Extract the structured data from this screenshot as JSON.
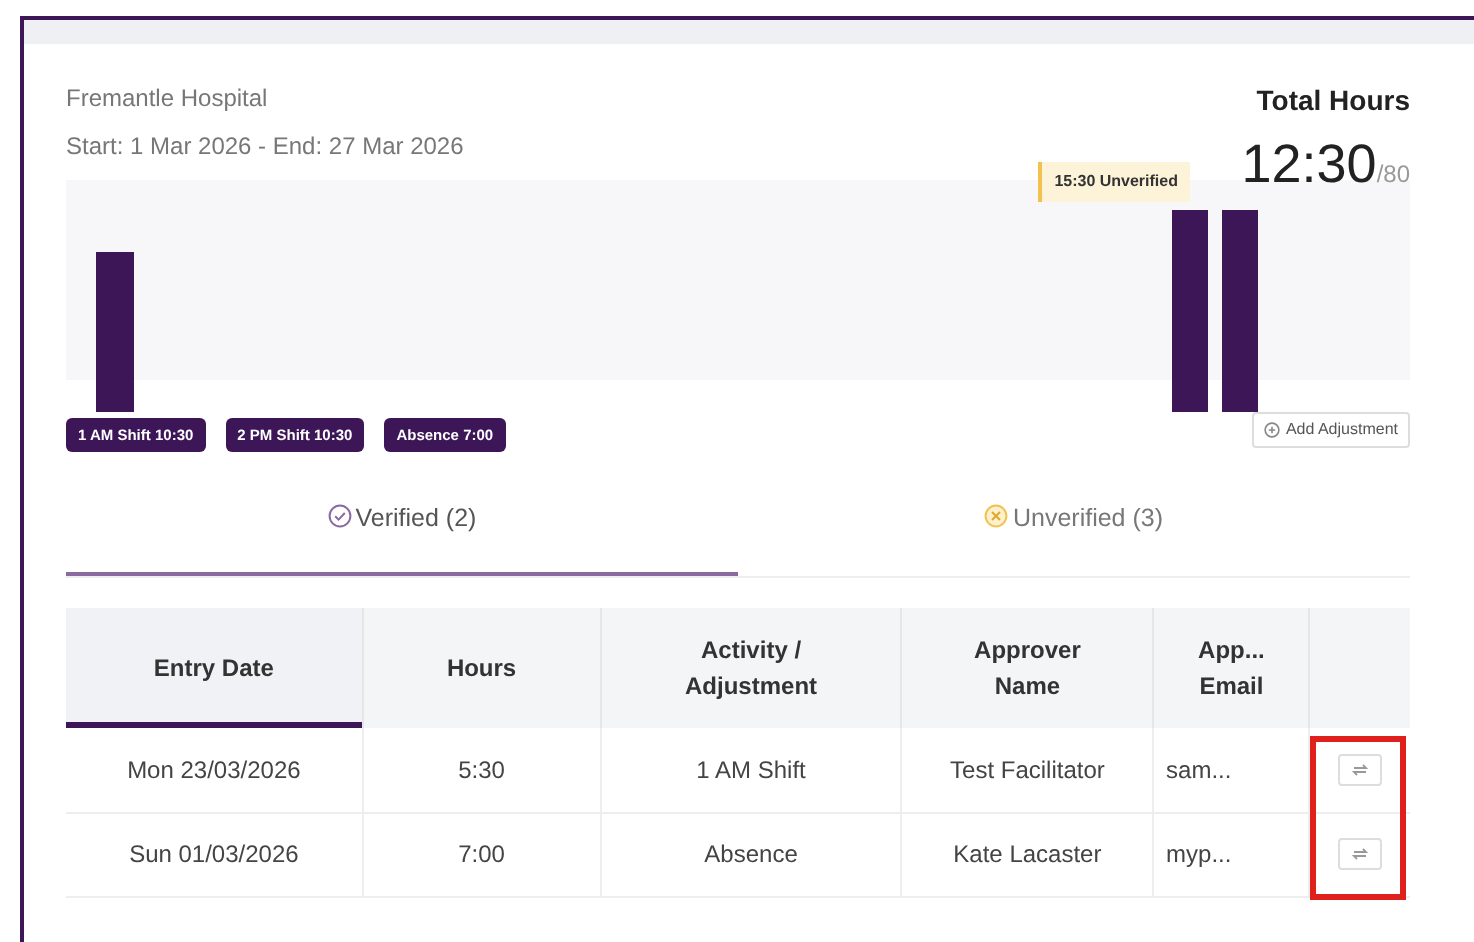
{
  "header": {
    "facility": "Fremantle Hospital",
    "period": "Start: 1 Mar 2026 - End: 27 Mar 2026"
  },
  "total": {
    "label": "Total Hours",
    "value": "12:30",
    "max": "/80"
  },
  "chart": {
    "unverified_tag": "15:30 Unverified",
    "legend": [
      {
        "label": "1 AM Shift",
        "value": "10:30"
      },
      {
        "label": "2 PM Shift",
        "value": "10:30"
      },
      {
        "label": "Absence",
        "value": "7:00"
      }
    ],
    "add_button": "Add Adjustment"
  },
  "tabs": [
    {
      "label": "Verified (2)",
      "kind": "verified",
      "selected": true
    },
    {
      "label": "Unverified (3)",
      "kind": "unverified",
      "selected": false
    }
  ],
  "table": {
    "columns": [
      {
        "label": "Entry Date",
        "sorted": true
      },
      {
        "label": "Hours",
        "sorted": false
      },
      {
        "label": "Activity / Adjustment",
        "sorted": false
      },
      {
        "label": "Approver Name",
        "sorted": false
      },
      {
        "label": "App... Email",
        "sorted": false
      }
    ],
    "rows": [
      {
        "cells": [
          "Mon 23/03/2026",
          "5:30",
          "1 AM Shift",
          "Test Facilitator",
          "sam..."
        ]
      },
      {
        "cells": [
          "Sun 01/03/2026",
          "7:00",
          "Absence",
          "Kate Lacaster",
          "myp..."
        ]
      }
    ]
  }
}
